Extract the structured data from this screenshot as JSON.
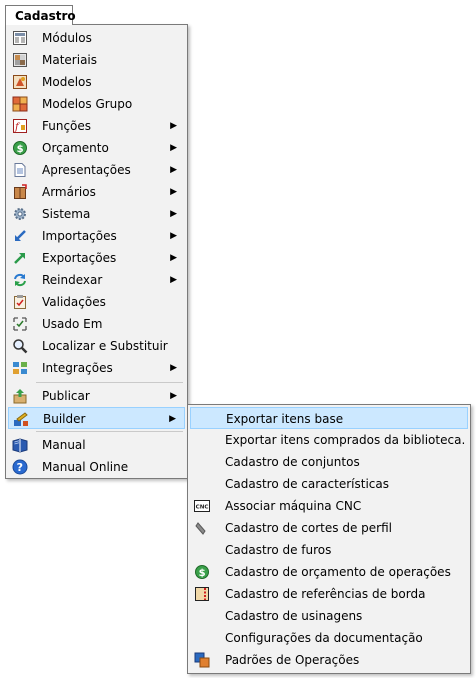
{
  "menubar": {
    "title": "Cadastro"
  },
  "cadastro_menu": {
    "items": [
      {
        "label": "Módulos",
        "icon": "modules-icon"
      },
      {
        "label": "Materiais",
        "icon": "materials-icon"
      },
      {
        "label": "Modelos",
        "icon": "models-icon"
      },
      {
        "label": "Modelos Grupo",
        "icon": "models-group-icon"
      },
      {
        "label": "Funções",
        "icon": "functions-icon",
        "submenu": true
      },
      {
        "label": "Orçamento",
        "icon": "budget-icon",
        "submenu": true
      },
      {
        "label": "Apresentações",
        "icon": "presentations-icon",
        "submenu": true
      },
      {
        "label": "Armários",
        "icon": "cabinets-icon",
        "submenu": true
      },
      {
        "label": "Sistema",
        "icon": "system-gear-icon",
        "submenu": true
      },
      {
        "label": "Importações",
        "icon": "imports-icon",
        "submenu": true
      },
      {
        "label": "Exportações",
        "icon": "exports-icon",
        "submenu": true
      },
      {
        "label": "Reindexar",
        "icon": "reindex-icon",
        "submenu": true
      },
      {
        "label": "Validações",
        "icon": "validations-icon"
      },
      {
        "label": "Usado Em",
        "icon": "used-in-icon"
      },
      {
        "label": "Localizar e Substituir",
        "icon": "find-replace-icon"
      },
      {
        "label": "Integrações",
        "icon": "integrations-icon",
        "submenu": true
      },
      {
        "label": "Publicar",
        "icon": "publish-icon",
        "submenu": true
      },
      {
        "label": "Builder",
        "icon": "builder-icon",
        "submenu": true,
        "highlighted": true
      },
      {
        "label": "Manual",
        "icon": "manual-book-icon"
      },
      {
        "label": "Manual Online",
        "icon": "help-icon"
      }
    ]
  },
  "builder_submenu": {
    "items": [
      {
        "label": "Exportar itens base",
        "highlighted": true
      },
      {
        "label": "Exportar itens comprados da biblioteca."
      },
      {
        "label": "Cadastro de conjuntos"
      },
      {
        "label": "Cadastro de características"
      },
      {
        "label": "Associar máquina CNC",
        "icon": "cnc-icon",
        "icon_text": "CNC"
      },
      {
        "label": "Cadastro de cortes de perfil",
        "icon": "profile-cut-icon"
      },
      {
        "label": "Cadastro de furos"
      },
      {
        "label": "Cadastro de orçamento de operações",
        "icon": "dollar-icon"
      },
      {
        "label": "Cadastro de referências de borda",
        "icon": "edge-reference-icon"
      },
      {
        "label": "Cadastro de usinagens"
      },
      {
        "label": "Configurações da documentação"
      },
      {
        "label": "Padrões de Operações",
        "icon": "operation-standards-icon"
      }
    ]
  },
  "colors": {
    "menu_background": "#f2f2f2",
    "highlight_background": "#cce8ff",
    "highlight_border": "#99d1ff",
    "border": "#7a7a7a"
  }
}
